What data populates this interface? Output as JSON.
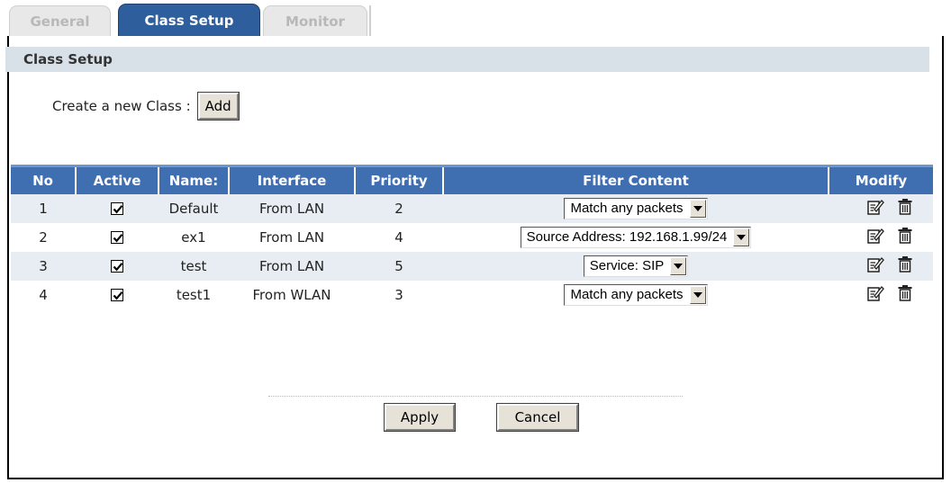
{
  "tabs": [
    {
      "label": "General",
      "active": false
    },
    {
      "label": "Class Setup",
      "active": true
    },
    {
      "label": "Monitor",
      "active": false
    }
  ],
  "section": {
    "title": "Class Setup"
  },
  "create": {
    "label": "Create a new Class :",
    "button": "Add"
  },
  "table": {
    "headers": [
      "No",
      "Active",
      "Name:",
      "Interface",
      "Priority",
      "Filter Content",
      "Modify"
    ],
    "rows": [
      {
        "no": "1",
        "active": true,
        "name": "Default",
        "interface": "From LAN",
        "priority": "2",
        "filter": "Match any packets"
      },
      {
        "no": "2",
        "active": true,
        "name": "ex1",
        "interface": "From LAN",
        "priority": "4",
        "filter": "Source Address: 192.168.1.99/24"
      },
      {
        "no": "3",
        "active": true,
        "name": "test",
        "interface": "From LAN",
        "priority": "5",
        "filter": "Service: SIP"
      },
      {
        "no": "4",
        "active": true,
        "name": "test1",
        "interface": "From WLAN",
        "priority": "3",
        "filter": "Match any packets"
      }
    ]
  },
  "icons": {
    "edit": "edit-icon",
    "delete": "trash-icon"
  },
  "actions": {
    "apply": "Apply",
    "cancel": "Cancel"
  },
  "colors": {
    "tab_active": "#2f5e9d",
    "table_header": "#3f6fb1",
    "row_alt": "#e7edf2",
    "section_bg": "#d9e1e8"
  }
}
